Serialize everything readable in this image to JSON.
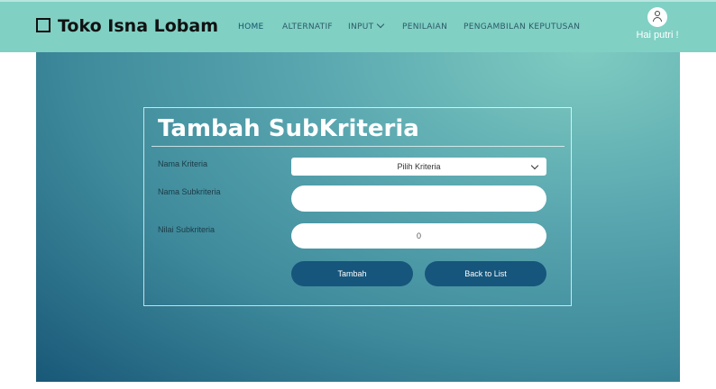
{
  "brand": {
    "name": "Toko Isna Lobam"
  },
  "nav": {
    "items": [
      {
        "label": "HOME"
      },
      {
        "label": "ALTERNATIF"
      },
      {
        "label": "INPUT"
      },
      {
        "label": "PENILAIAN"
      },
      {
        "label": "PENGAMBILAN KEPUTUSAN"
      }
    ]
  },
  "user": {
    "greeting": "Hai putri !"
  },
  "form": {
    "title": "Tambah SubKriteria",
    "kriteria_label": "Nama Kriteria",
    "kriteria_selected": "Pilih Kriteria",
    "subkriteria_label": "Nama Subkriteria",
    "subkriteria_value": "",
    "nilai_label": "Nilai Subkriteria",
    "nilai_value": "0",
    "add_button": "Tambah",
    "back_button": "Back to List"
  },
  "colors": {
    "header": "#80d0c4",
    "button": "#16567c"
  }
}
